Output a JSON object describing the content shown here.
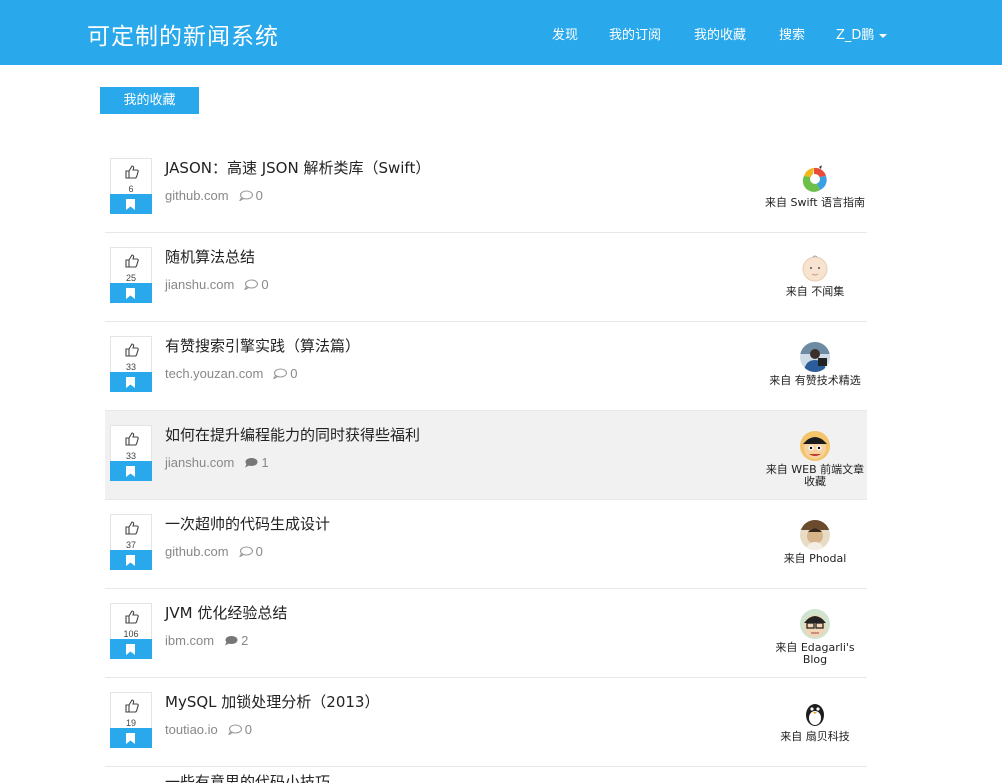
{
  "navbar": {
    "brand": "可定制的新闻系统",
    "links": [
      "发现",
      "我的订阅",
      "我的收藏",
      "搜索"
    ],
    "user": "Z_D鹏"
  },
  "section": {
    "label": "我的收藏"
  },
  "colors": {
    "accent": "#29a8ec"
  },
  "items": [
    {
      "votes": "6",
      "title": "JASON：高速 JSON 解析类库（Swift）",
      "domain": "github.com",
      "comments": "0",
      "source": "来自 Swift 语言指南",
      "avatar_icon": "swift-guide-avatar"
    },
    {
      "votes": "25",
      "title": "随机算法总结",
      "domain": "jianshu.com",
      "comments": "0",
      "source": "来自 不闻集",
      "avatar_icon": "buwenji-avatar"
    },
    {
      "votes": "33",
      "title": "有赞搜索引擎实践（算法篇）",
      "domain": "tech.youzan.com",
      "comments": "0",
      "source": "来自 有赞技术精选",
      "avatar_icon": "youzan-avatar"
    },
    {
      "votes": "33",
      "title": "如何在提升编程能力的同时获得些福利",
      "domain": "jianshu.com",
      "comments": "1",
      "source": "来自 WEB 前端文章收藏",
      "avatar_icon": "luffy-avatar"
    },
    {
      "votes": "37",
      "title": "一次超帅的代码生成设计",
      "domain": "github.com",
      "comments": "0",
      "source": "来自 Phodal",
      "avatar_icon": "phodal-avatar"
    },
    {
      "votes": "106",
      "title": "JVM 优化经验总结",
      "domain": "ibm.com",
      "comments": "2",
      "source": "来自 Edagarli's Blog",
      "avatar_icon": "edagarli-avatar"
    },
    {
      "votes": "19",
      "title": "MySQL 加锁处理分析（2013）",
      "domain": "toutiao.io",
      "comments": "0",
      "source": "来自 扇贝科技",
      "avatar_icon": "penguin-avatar"
    }
  ],
  "next_item_peek": "一些有意思的代码小技巧..."
}
